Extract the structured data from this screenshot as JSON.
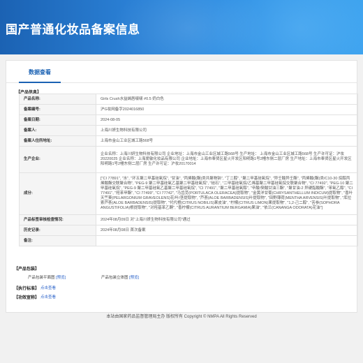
{
  "header": {
    "title": "国产普通化妆品备案信息"
  },
  "tabs": [
    {
      "label": "数据查看"
    }
  ],
  "sections": {
    "product_info": "【产品信息】",
    "packaging": "【产品包装】",
    "execution_standard": "【执行标准】",
    "efficacy": "【功效宣称】"
  },
  "info_rows": [
    {
      "key": "产品名称:",
      "value": "Girls Crush水益嫣唇啵啵 #0.5 奶白色"
    },
    {
      "key": "备案编号:",
      "value": "沪G妆网备字2024016850"
    },
    {
      "key": "备案日期:",
      "value": "2024-08-05"
    },
    {
      "key": "备案人:",
      "value": "上海川妍生物科技有限公司"
    },
    {
      "key": "备案人住所地址:",
      "value": "上海市金山工业区城工路568号"
    },
    {
      "key": "生产企业:",
      "value": "企业名称：上海川妍生物科技有限公司 企业地址：上海市金山工业区城工路568号 生产地址：      上海市金山工业区城工路568号 生产许可证：沪妆20220025 企业名称：上海爱敏化妆品有限公司 企业地址：上海市奉贤区星火开发区阳明路1号2幢东侧二层厂房 生产地址：上海市奉贤区星火开发区阳明路1号2幢东侧二层厂房 生产许可证：沪妆20170014"
    },
    {
      "key": "成分:",
      "value": "[\"CI 77891\", \"水\", \"环五聚二甲基硅氧烷\", \"甘油\", \"丙烯酸(酯)类共聚物钠\", \"丁二醇\", \"聚二甲基硅氧烷\", \"异壬酸异壬酯\", \"丙烯酸(酯)类/C10-30 烷醇丙烯酸酯交联聚合物\", \"PEG-9 聚二甲基硅氧乙基聚二甲基硅氧烷\", \"硅石\", \"二甲基硅氧烷/乙烯基聚二甲基硅氧烷交联聚合物\", \"CI 77492\", \"PEG-10 聚二甲基硅氧烷\", \"PEG-9 聚二甲基硅氧乙基聚二甲基硅氧烷\", \"CI 77491\", \"聚二甲基硅氧醇\", \"辛酸/癸酸甘油三酯\", \"聚甘油-2 异硬脂酸酯\", \"苯氧乙醇\", \"CI 77491\", \"羟苯甲酯\", \"CI 77499\", \"CI 77742\", \"马齿苋(PORTULACA OLERACEA)提取物\", \"金黄洋甘菊(CHRYSANTHELLUM INDICUM)提取物\", \"香叶天竺葵(PELARGONIUM GRAVEOLENS)花/叶/茎提取物\", \"芦荟(ALOE BARBADENSIS)叶提取物\", \"田野薄荷(MENTHA ARVENSIS)叶提取物\", \"库拉索芦荟(ALOE BARBADENSIS)提取物\", \"代代橙(CITRUS NOBILIS)果皮油\", \"柠檬(CITRUS LIMON)果提取物\", \"1,2-己二醇\", \"苦参(SOPHORA ANGUSTIFOLIA)根提取物\", \"对羟基苯乙酮\", \"香柠檬(CITRUS AURANTIUM BERGAMIA)果油\", \"依兰(CANANGA ODORATA)花油\"]"
    },
    {
      "key": "产品标签审核检查情况:",
      "value": "2024年08月09日 对“上海川妍生物科技有限公司”通过"
    },
    {
      "key": "历史记录:",
      "value": "2024年08月08日 首次备案"
    },
    {
      "key": "备注:",
      "value": ""
    }
  ],
  "packaging": {
    "flat_label": "产品包装平面图",
    "flat_link": "[预览]",
    "stereo_label": "产品包装立体图",
    "stereo_link": "[预览]"
  },
  "execution": {
    "link": "点击查看"
  },
  "efficacy": {
    "link": "点击查看"
  },
  "footer": {
    "text": "本站由国家药品监督管理局主办 版权所有 Copyright © NMPA All Rights Reserved"
  }
}
